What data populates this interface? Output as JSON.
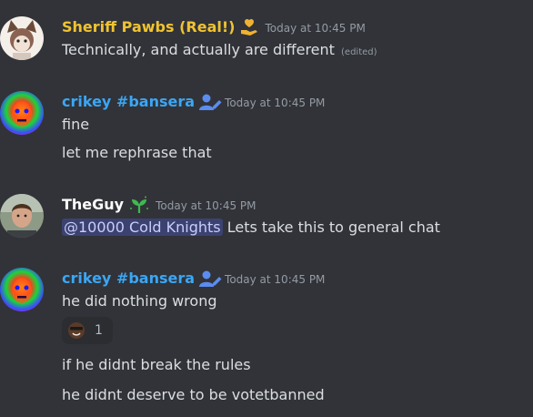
{
  "messages": [
    {
      "username": "Sheriff Pawbs (Real!)",
      "username_color": "#f0c330",
      "timestamp": "Today at 10:45 PM",
      "lines": [
        "Technically, and actually are different"
      ],
      "edited": "(edited)",
      "badge_icon": "hand-heart-icon"
    },
    {
      "username": "crikey #bansera",
      "username_color": "#3ba6f5",
      "timestamp": "Today at 10:45 PM",
      "lines": [
        "fine",
        "let me rephrase that"
      ],
      "badge_icon": "user-edit-icon"
    },
    {
      "username": "TheGuy",
      "username_color": "#ffffff",
      "timestamp": "Today at 10:45 PM",
      "mention": "@10000 Cold Knights",
      "lines": [
        "Lets take this to general chat"
      ],
      "badge_icon": "sprout-icon"
    },
    {
      "username": "crikey #bansera",
      "username_color": "#3ba6f5",
      "timestamp": "Today at 10:45 PM",
      "lines": [
        "he did nothing wrong",
        "if he didnt break the rules",
        "he didnt deserve to be votetbanned"
      ],
      "badge_icon": "user-edit-icon",
      "reaction": {
        "emoji_icon": "face-emoji-icon",
        "count": "1"
      }
    }
  ]
}
